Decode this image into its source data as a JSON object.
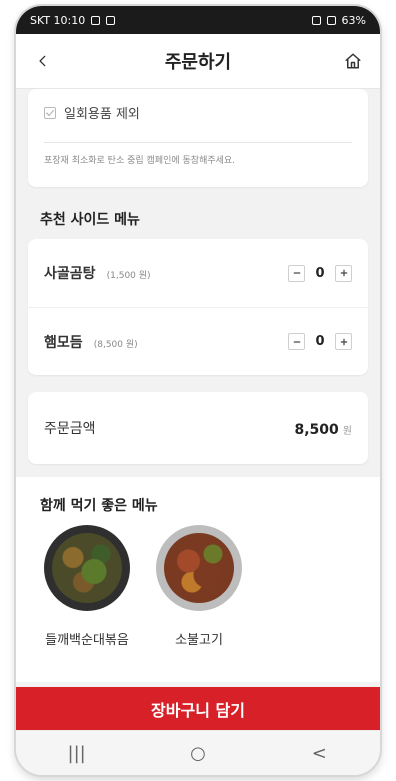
{
  "status_bar": {
    "left_text": "SKT 10:10",
    "right_text": "63%"
  },
  "header": {
    "title": "주문하기"
  },
  "exclude": {
    "label": "일회용품 제외",
    "checked": true,
    "note": "포장재 최소화로 탄소 중립 캠페인에 동참해주세요."
  },
  "side_menu": {
    "title": "추천 사이드 메뉴",
    "items": [
      {
        "name": "사골곰탕",
        "price": "(1,500 원)",
        "qty": "0"
      },
      {
        "name": "햄모듬",
        "price": "(8,500 원)",
        "qty": "0"
      }
    ]
  },
  "total": {
    "label": "주문금액",
    "value": "8,500",
    "unit": "원"
  },
  "pairing": {
    "title": "함께 먹기 좋은 메뉴",
    "items": [
      {
        "label": "들깨백순대볶음"
      },
      {
        "label": "소불고기"
      }
    ]
  },
  "cta": {
    "label": "장바구니 담기"
  },
  "navbar": {
    "recent": "|||",
    "home": "○",
    "back": "<"
  },
  "colors": {
    "accent_red": "#d82029",
    "background": "#f2f2f2"
  },
  "icons": {
    "back": "back-chevron-icon",
    "home": "home-icon",
    "checkbox": "check-icon"
  }
}
